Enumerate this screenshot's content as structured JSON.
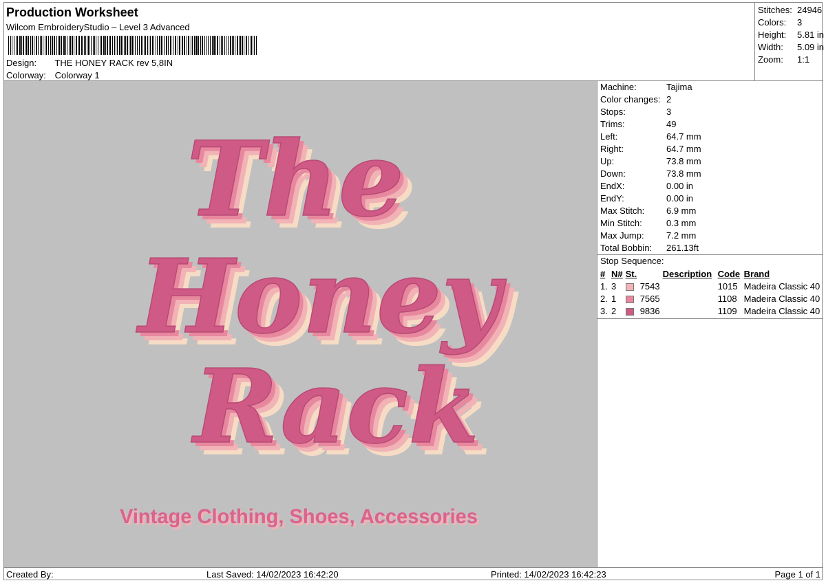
{
  "header": {
    "title": "Production Worksheet",
    "software": "Wilcom EmbroideryStudio – Level 3 Advanced",
    "design_label": "Design:",
    "design_value": "THE HONEY RACK rev 5,8IN",
    "colorway_label": "Colorway:",
    "colorway_value": "Colorway 1"
  },
  "summary": [
    {
      "label": "Stitches:",
      "value": "24946"
    },
    {
      "label": "Colors:",
      "value": "3"
    },
    {
      "label": "Height:",
      "value": "5.81 in"
    },
    {
      "label": "Width:",
      "value": "5.09 in"
    },
    {
      "label": "Zoom:",
      "value": "1:1"
    }
  ],
  "machine": [
    {
      "label": "Machine:",
      "value": "Tajima"
    },
    {
      "label": "Color changes:",
      "value": "2"
    },
    {
      "label": "Stops:",
      "value": "3"
    },
    {
      "label": "Trims:",
      "value": "49"
    },
    {
      "label": "Left:",
      "value": "64.7 mm"
    },
    {
      "label": "Right:",
      "value": "64.7 mm"
    },
    {
      "label": "Up:",
      "value": "73.8 mm"
    },
    {
      "label": "Down:",
      "value": "73.8 mm"
    },
    {
      "label": "EndX:",
      "value": "0.00 in"
    },
    {
      "label": "EndY:",
      "value": "0.00 in"
    },
    {
      "label": "Max Stitch:",
      "value": "6.9 mm"
    },
    {
      "label": "Min Stitch:",
      "value": "0.3 mm"
    },
    {
      "label": "Max Jump:",
      "value": "7.2 mm"
    },
    {
      "label": "Total Bobbin:",
      "value": "261.13ft"
    }
  ],
  "stop_sequence": {
    "title": "Stop Sequence:",
    "headers": {
      "num": "#",
      "n": "N#",
      "st": "St.",
      "desc": "Description",
      "code": "Code",
      "brand": "Brand"
    },
    "rows": [
      {
        "num": "1.",
        "n": "3",
        "color": "#f1b3b6",
        "st": "7543",
        "desc": "",
        "code": "1015",
        "brand": "Madeira Classic 40"
      },
      {
        "num": "2.",
        "n": "1",
        "color": "#e8889f",
        "st": "7565",
        "desc": "",
        "code": "1108",
        "brand": "Madeira Classic 40"
      },
      {
        "num": "3.",
        "n": "2",
        "color": "#cf5a86",
        "st": "9836",
        "desc": "",
        "code": "1109",
        "brand": "Madeira Classic 40"
      }
    ]
  },
  "design": {
    "line1": "The",
    "line2": "Honey",
    "line3": "Rack",
    "tagline": "Vintage Clothing, Shoes, Accessories",
    "thread_colors": {
      "cream": "#f6dcc4",
      "peach": "#f1b3b6",
      "pink": "#e8889f",
      "rose": "#cf5a86"
    }
  },
  "footer": {
    "created_by": "Created By:",
    "last_saved": "Last Saved: 14/02/2023 16:42:20",
    "printed": "Printed: 14/02/2023 16:42:23",
    "page": "Page 1 of 1"
  }
}
